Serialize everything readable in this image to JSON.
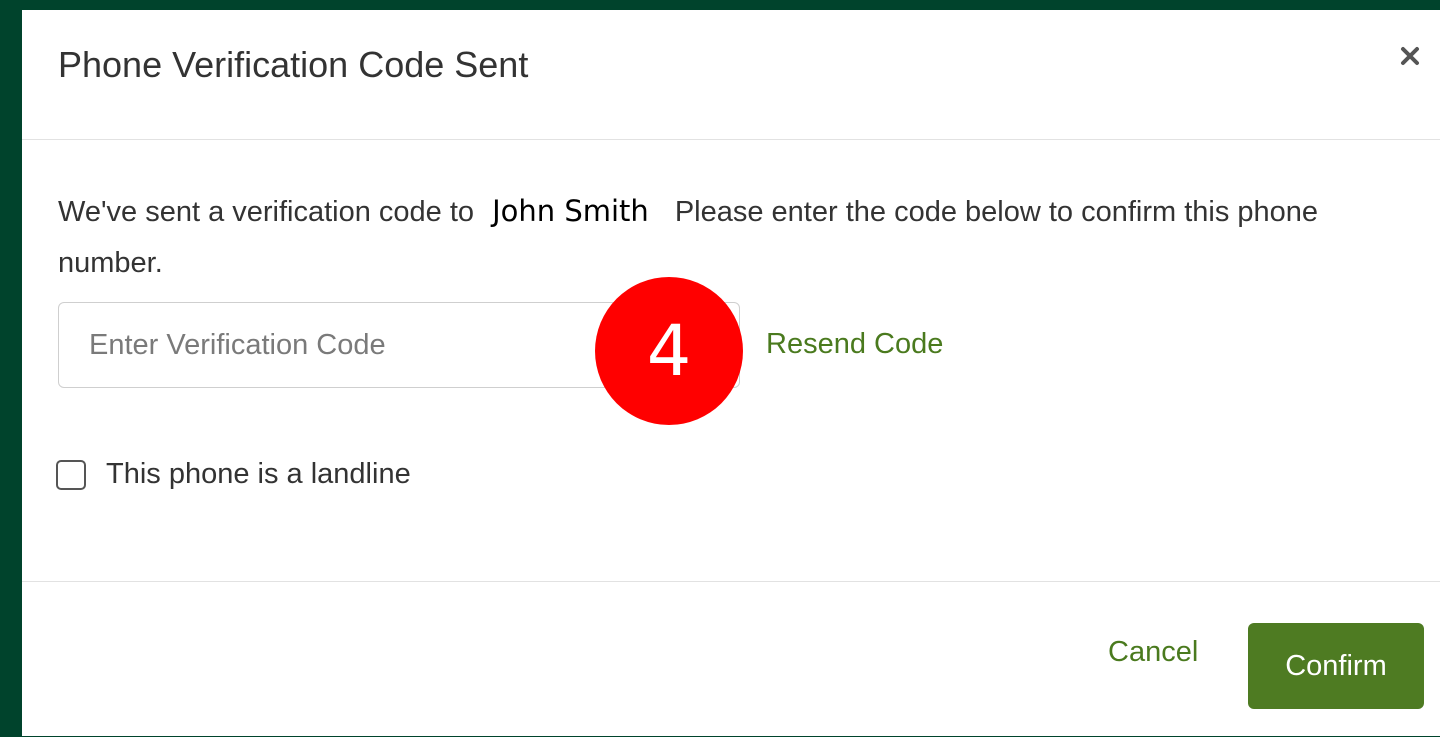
{
  "dialog": {
    "title": "Phone Verification Code Sent",
    "message_before": "We've sent a verification code to",
    "recipient_name": "John Smith",
    "message_after": "Please enter the code below to confirm this phone number.",
    "code_input": {
      "placeholder": "Enter Verification Code",
      "value": ""
    },
    "step_badge": "4",
    "resend_label": "Resend Code",
    "landline_label": "This phone is a landline",
    "landline_checked": false,
    "cancel_label": "Cancel",
    "confirm_label": "Confirm"
  },
  "icons": {
    "close": "close-icon"
  },
  "colors": {
    "background": "#00432c",
    "accent_green": "#4e7b22",
    "link_green": "#4a7a1e",
    "badge_red": "#ff0000"
  }
}
